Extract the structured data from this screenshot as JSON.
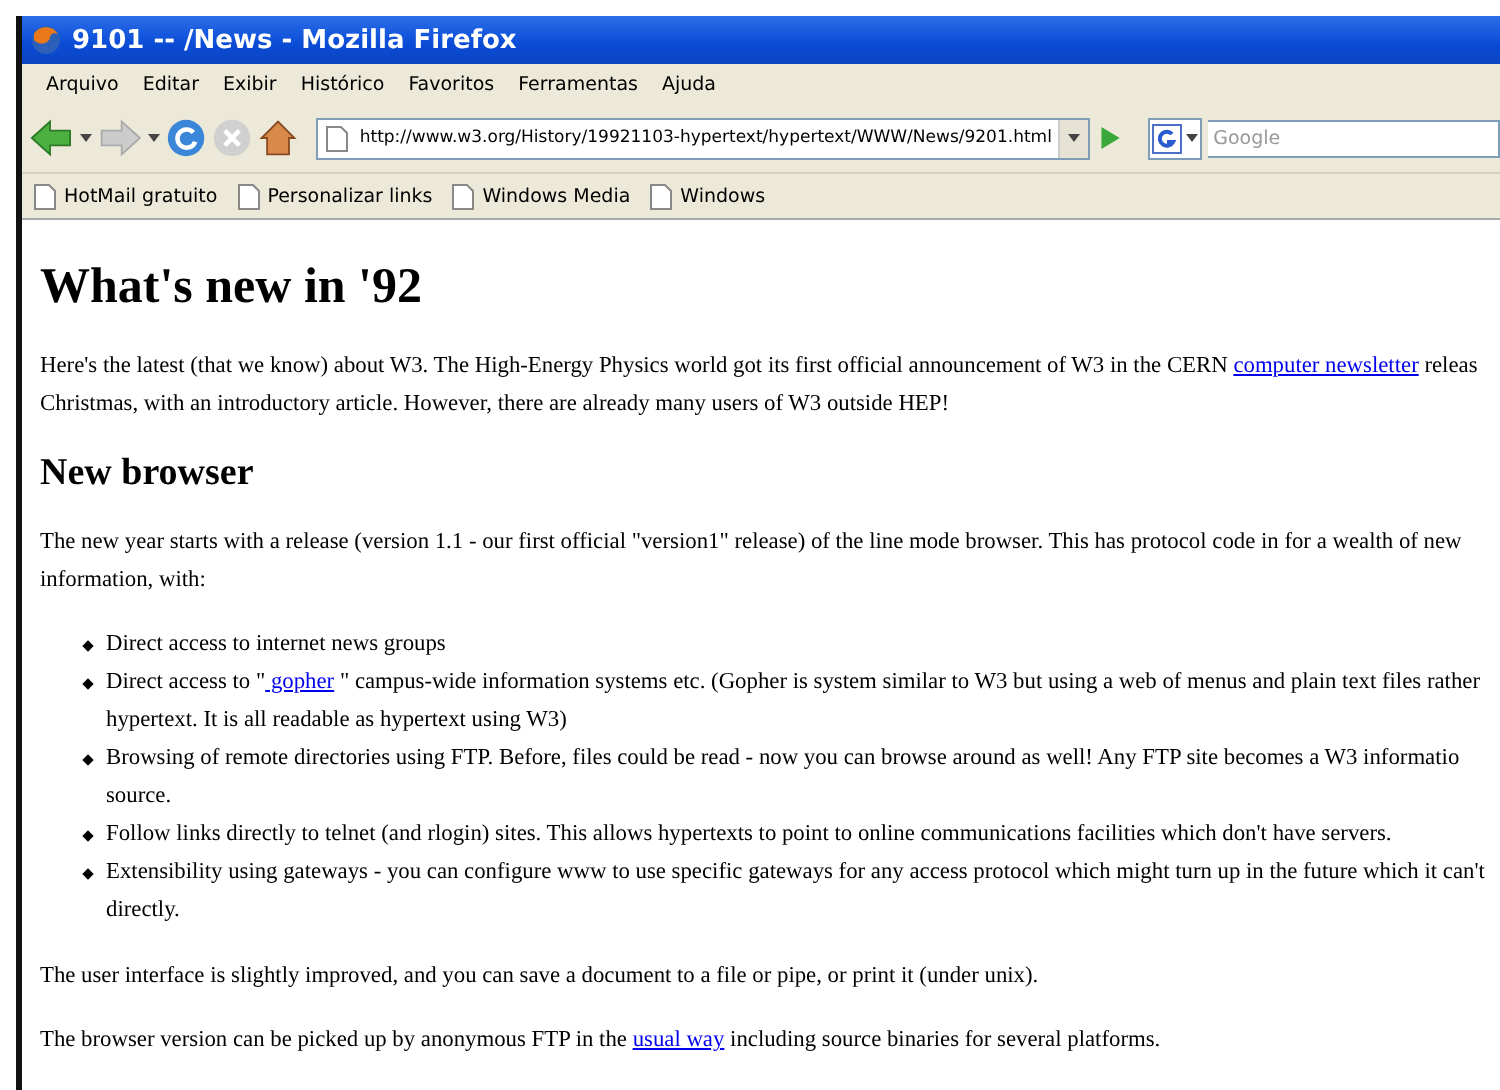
{
  "window": {
    "title": "9101 -- /News - Mozilla Firefox"
  },
  "menu": [
    "Arquivo",
    "Editar",
    "Exibir",
    "Histórico",
    "Favoritos",
    "Ferramentas",
    "Ajuda"
  ],
  "address": {
    "value": "http://www.w3.org/History/19921103-hypertext/hypertext/WWW/News/9201.html"
  },
  "search": {
    "placeholder": "Google"
  },
  "bookmarks": [
    "HotMail gratuito",
    "Personalizar links",
    "Windows Media",
    "Windows"
  ],
  "page": {
    "title": "What's new in '92",
    "intro": [
      [
        {
          "text": "Here's the latest (that we know) about W3. The High-Energy Physics world got its first official announcement of W3 in the CERN "
        },
        {
          "link": "computer newsletter"
        },
        {
          "text": " releas"
        }
      ],
      [
        {
          "text": "Christmas, with an introductory article. However, there are already many users of W3 outside HEP!"
        }
      ]
    ],
    "section": "New browser",
    "lead": [
      [
        {
          "text": "The new year starts with a release (version 1.1 - our first official \"version1\" release) of the line mode browser. This has protocol code in for a wealth of new"
        }
      ],
      [
        {
          "text": "information, with:"
        }
      ]
    ],
    "bullets": [
      [
        [
          {
            "text": "Direct access to internet news groups"
          }
        ]
      ],
      [
        [
          {
            "text": "Direct access to \""
          },
          {
            "link": " gopher"
          },
          {
            "text": " \" campus-wide information systems etc. (Gopher is system similar to W3 but using a web of menus and plain text files rather"
          }
        ],
        [
          {
            "text": "hypertext. It is all readable as hypertext using W3)"
          }
        ]
      ],
      [
        [
          {
            "text": "Browsing of remote directories using FTP. Before, files could be read - now you can browse around as well! Any FTP site becomes a W3 informatio"
          }
        ],
        [
          {
            "text": "source."
          }
        ]
      ],
      [
        [
          {
            "text": "Follow links directly to telnet (and rlogin) sites. This allows hypertexts to point to online communications facilities which don't have servers."
          }
        ]
      ],
      [
        [
          {
            "text": "Extensibility using gateways - you can configure www to use specific gateways for any access protocol which might turn up in the future which it can't"
          }
        ],
        [
          {
            "text": "directly."
          }
        ]
      ]
    ],
    "after": [
      [
        [
          {
            "text": "The user interface is slightly improved, and you can save a document to a file or pipe, or print it (under unix)."
          }
        ]
      ],
      [
        [
          {
            "text": "The browser version can be picked up by anonymous FTP in the "
          },
          {
            "link": "usual way"
          },
          {
            "text": " including source binaries for several platforms."
          }
        ]
      ]
    ]
  }
}
